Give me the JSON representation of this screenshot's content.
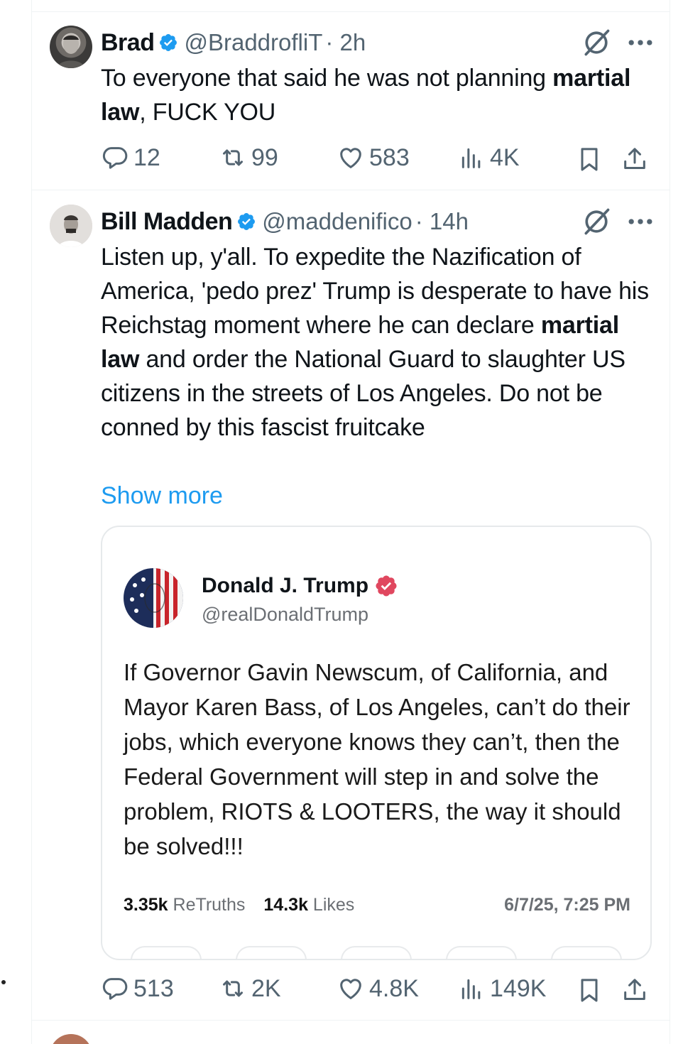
{
  "tweets": [
    {
      "name": "Brad",
      "handle": "@BraddrofliT",
      "time": "· 2h",
      "text_parts": [
        {
          "t": "To everyone that said he was not planning ",
          "b": false
        },
        {
          "t": "martial law",
          "b": true
        },
        {
          "t": ", FUCK YOU",
          "b": false
        }
      ],
      "replies": "12",
      "reposts": "99",
      "likes": "583",
      "views": "4K"
    },
    {
      "name": "Bill Madden",
      "handle": "@maddenifico",
      "time": "· 14h",
      "text_parts": [
        {
          "t": "Listen up, y'all. To expedite the Nazification of America, 'pedo prez' Trump is desperate to have his Reichstag moment where he can declare ",
          "b": false
        },
        {
          "t": "martial law",
          "b": true
        },
        {
          "t": " and order the National Guard to slaughter US citizens in the streets of Los Angeles. Do not be conned by this fascist fruitcake",
          "b": false
        }
      ],
      "show_more": "Show more",
      "replies": "513",
      "reposts": "2K",
      "likes": "4.8K",
      "views": "149K"
    }
  ],
  "quote": {
    "name": "Donald J. Trump",
    "handle": "@realDonaldTrump",
    "text": "If Governor Gavin Newscum, of California, and Mayor Karen Bass, of Los Angeles, can’t do their jobs, which everyone knows they can’t, then the Federal Government will step in and solve the problem, RIOTS & LOOTERS, the way it should be solved!!!",
    "retruths_count": "3.35k",
    "retruths_label": "ReTruths",
    "likes_count": "14.3k",
    "likes_label": "Likes",
    "date": "6/7/25, 7:25 PM"
  },
  "colors": {
    "verified": "#1d9bf0",
    "truth_verified": "#e0475f",
    "muted": "#536471",
    "link": "#1d9bf0"
  },
  "icons": [
    "verified-badge-icon",
    "grok-icon",
    "more-icon",
    "reply-icon",
    "repost-icon",
    "like-icon",
    "views-icon",
    "bookmark-icon",
    "share-icon"
  ]
}
